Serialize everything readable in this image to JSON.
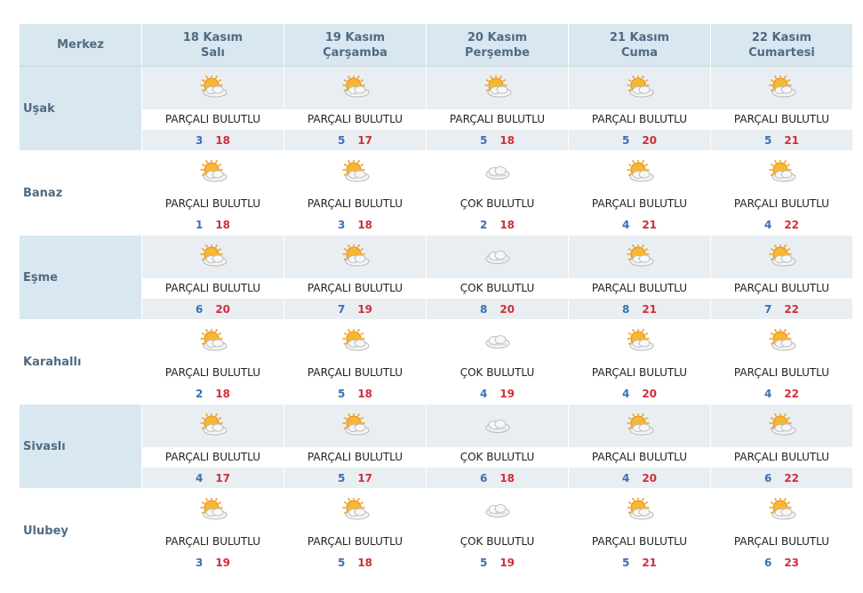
{
  "header": {
    "merkez_label": "Merkez",
    "days": [
      {
        "date": "18 Kasım",
        "weekday": "Salı"
      },
      {
        "date": "19 Kasım",
        "weekday": "Çarşamba"
      },
      {
        "date": "20 Kasım",
        "weekday": "Perşembe"
      },
      {
        "date": "21 Kasım",
        "weekday": "Cuma"
      },
      {
        "date": "22 Kasım",
        "weekday": "Cumartesi"
      }
    ]
  },
  "rows": [
    {
      "city": "Uşak",
      "days": [
        {
          "icon": "partly-cloudy-icon",
          "condition": "PARÇALI BULUTLU",
          "min": "3",
          "max": "18"
        },
        {
          "icon": "partly-cloudy-icon",
          "condition": "PARÇALI BULUTLU",
          "min": "5",
          "max": "17"
        },
        {
          "icon": "partly-cloudy-icon",
          "condition": "PARÇALI BULUTLU",
          "min": "5",
          "max": "18"
        },
        {
          "icon": "partly-cloudy-icon",
          "condition": "PARÇALI BULUTLU",
          "min": "5",
          "max": "20"
        },
        {
          "icon": "partly-cloudy-icon",
          "condition": "PARÇALI BULUTLU",
          "min": "5",
          "max": "21"
        }
      ]
    },
    {
      "city": "Banaz",
      "days": [
        {
          "icon": "partly-cloudy-icon",
          "condition": "PARÇALI BULUTLU",
          "min": "1",
          "max": "18"
        },
        {
          "icon": "partly-cloudy-icon",
          "condition": "PARÇALI BULUTLU",
          "min": "3",
          "max": "18"
        },
        {
          "icon": "cloudy-icon",
          "condition": "ÇOK BULUTLU",
          "min": "2",
          "max": "18"
        },
        {
          "icon": "partly-cloudy-icon",
          "condition": "PARÇALI BULUTLU",
          "min": "4",
          "max": "21"
        },
        {
          "icon": "partly-cloudy-icon",
          "condition": "PARÇALI BULUTLU",
          "min": "4",
          "max": "22"
        }
      ]
    },
    {
      "city": "Eşme",
      "days": [
        {
          "icon": "partly-cloudy-icon",
          "condition": "PARÇALI BULUTLU",
          "min": "6",
          "max": "20"
        },
        {
          "icon": "partly-cloudy-icon",
          "condition": "PARÇALI BULUTLU",
          "min": "7",
          "max": "19"
        },
        {
          "icon": "cloudy-icon",
          "condition": "ÇOK BULUTLU",
          "min": "8",
          "max": "20"
        },
        {
          "icon": "partly-cloudy-icon",
          "condition": "PARÇALI BULUTLU",
          "min": "8",
          "max": "21"
        },
        {
          "icon": "partly-cloudy-icon",
          "condition": "PARÇALI BULUTLU",
          "min": "7",
          "max": "22"
        }
      ]
    },
    {
      "city": "Karahallı",
      "days": [
        {
          "icon": "partly-cloudy-icon",
          "condition": "PARÇALI BULUTLU",
          "min": "2",
          "max": "18"
        },
        {
          "icon": "partly-cloudy-icon",
          "condition": "PARÇALI BULUTLU",
          "min": "5",
          "max": "18"
        },
        {
          "icon": "cloudy-icon",
          "condition": "ÇOK BULUTLU",
          "min": "4",
          "max": "19"
        },
        {
          "icon": "partly-cloudy-icon",
          "condition": "PARÇALI BULUTLU",
          "min": "4",
          "max": "20"
        },
        {
          "icon": "partly-cloudy-icon",
          "condition": "PARÇALI BULUTLU",
          "min": "4",
          "max": "22"
        }
      ]
    },
    {
      "city": "Sivaslı",
      "days": [
        {
          "icon": "partly-cloudy-icon",
          "condition": "PARÇALI BULUTLU",
          "min": "4",
          "max": "17"
        },
        {
          "icon": "partly-cloudy-icon",
          "condition": "PARÇALI BULUTLU",
          "min": "5",
          "max": "17"
        },
        {
          "icon": "cloudy-icon",
          "condition": "ÇOK BULUTLU",
          "min": "6",
          "max": "18"
        },
        {
          "icon": "partly-cloudy-icon",
          "condition": "PARÇALI BULUTLU",
          "min": "4",
          "max": "20"
        },
        {
          "icon": "partly-cloudy-icon",
          "condition": "PARÇALI BULUTLU",
          "min": "6",
          "max": "22"
        }
      ]
    },
    {
      "city": "Ulubey",
      "days": [
        {
          "icon": "partly-cloudy-icon",
          "condition": "PARÇALI BULUTLU",
          "min": "3",
          "max": "19"
        },
        {
          "icon": "partly-cloudy-icon",
          "condition": "PARÇALI BULUTLU",
          "min": "5",
          "max": "18"
        },
        {
          "icon": "cloudy-icon",
          "condition": "ÇOK BULUTLU",
          "min": "5",
          "max": "19"
        },
        {
          "icon": "partly-cloudy-icon",
          "condition": "PARÇALI BULUTLU",
          "min": "5",
          "max": "21"
        },
        {
          "icon": "partly-cloudy-icon",
          "condition": "PARÇALI BULUTLU",
          "min": "6",
          "max": "23"
        }
      ]
    }
  ],
  "colors": {
    "header_bg": "#d9e7f0",
    "header_text": "#4f6b82",
    "min_temp": "#3a6fb5",
    "max_temp": "#d02f3a"
  }
}
